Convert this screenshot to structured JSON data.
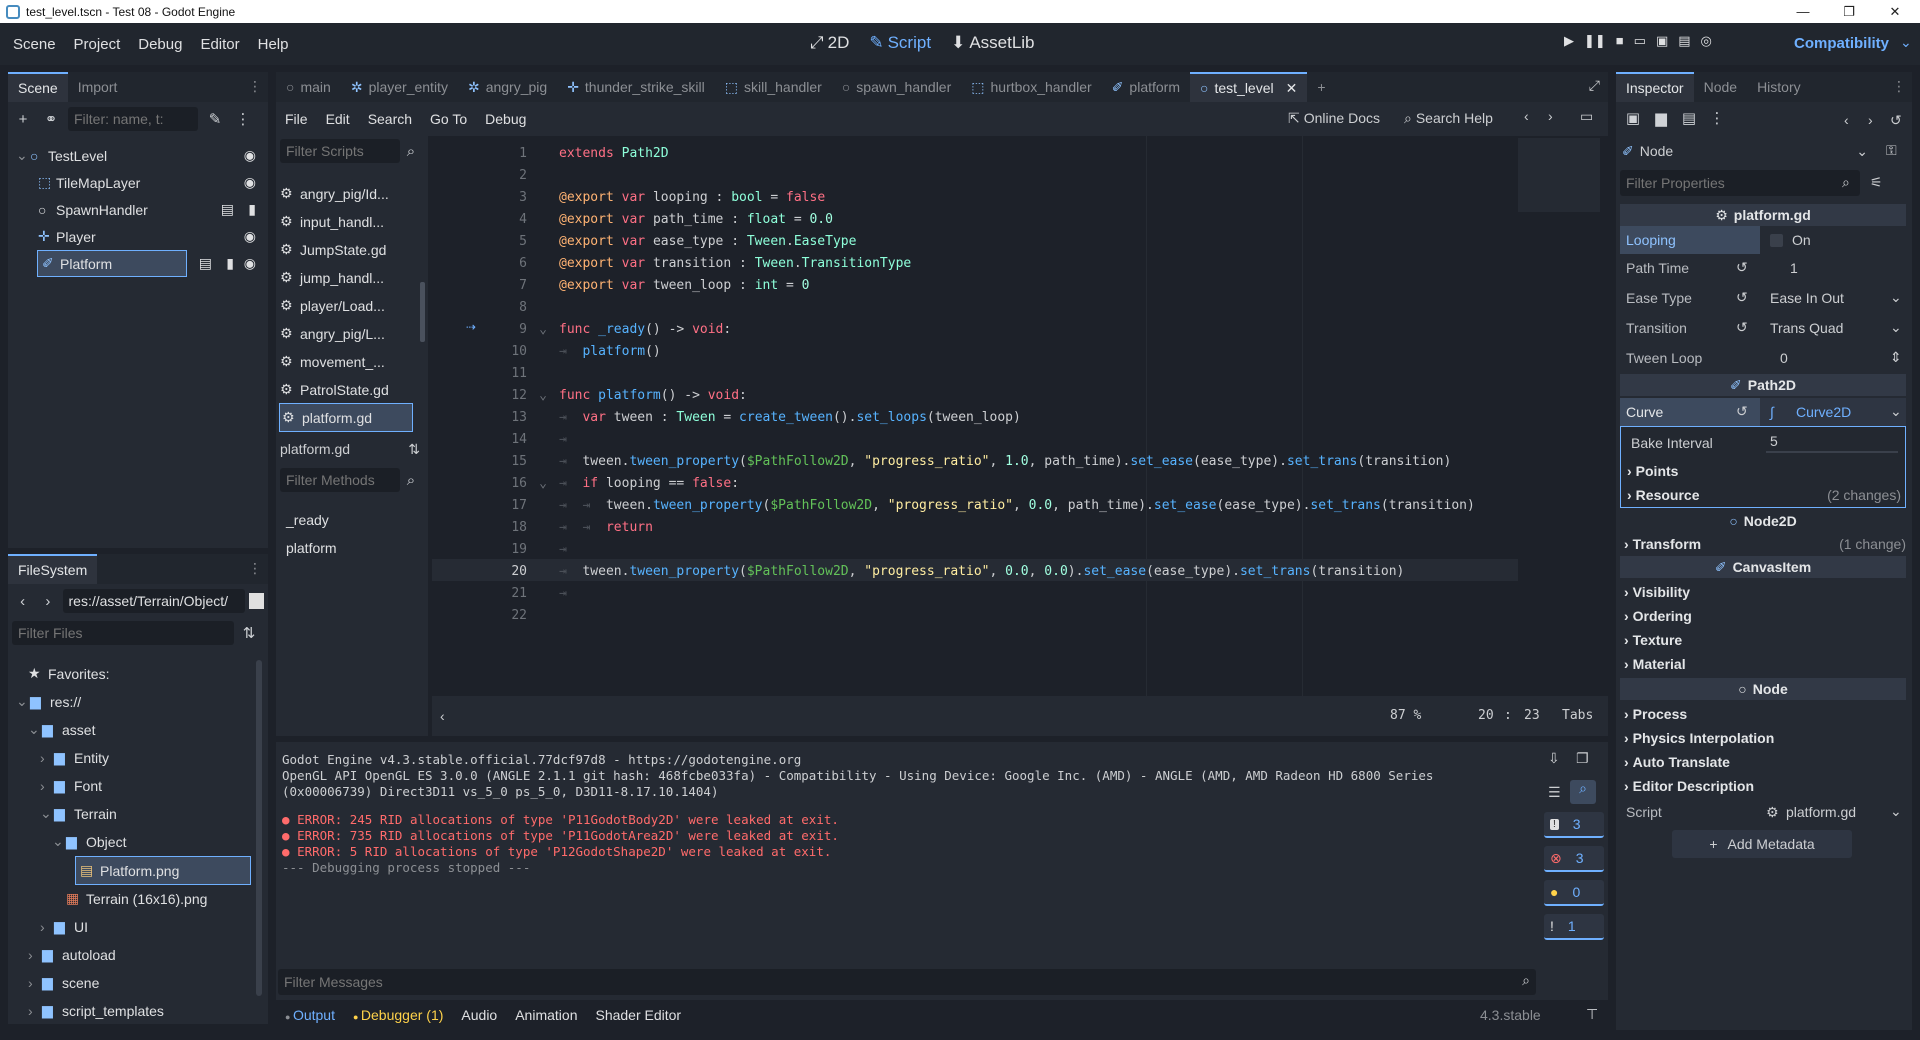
{
  "window": {
    "title": "test_level.tscn - Test 08 - Godot Engine",
    "min": "—",
    "max": "❐",
    "close": "✕"
  },
  "menu": [
    "Scene",
    "Project",
    "Debug",
    "Editor",
    "Help"
  ],
  "workspaces": [
    {
      "label": "2D",
      "icon": "⤢"
    },
    {
      "label": "Script",
      "icon": "✎"
    },
    {
      "label": "AssetLib",
      "icon": "⬇"
    }
  ],
  "renderer": "Compatibility",
  "scene_panel": {
    "tabs": [
      "Scene",
      "Import"
    ],
    "filter_placeholder": "Filter: name, t:",
    "nodes": [
      {
        "label": "TestLevel",
        "icon": "○"
      },
      {
        "label": "TileMapLayer",
        "icon": "⬚"
      },
      {
        "label": "SpawnHandler",
        "icon": "○"
      },
      {
        "label": "Player",
        "icon": "✛"
      },
      {
        "label": "Platform",
        "icon": "✐"
      }
    ]
  },
  "filesystem": {
    "title": "FileSystem",
    "path": "res://asset/Terrain/Object/",
    "filter_placeholder": "Filter Files",
    "items": [
      {
        "label": "Favorites:",
        "icon": "★"
      },
      {
        "label": "res://",
        "icon": "▆"
      },
      {
        "label": "asset",
        "icon": "▆"
      },
      {
        "label": "Entity",
        "icon": "▆"
      },
      {
        "label": "Font",
        "icon": "▆"
      },
      {
        "label": "Terrain",
        "icon": "▆"
      },
      {
        "label": "Object",
        "icon": "▆"
      },
      {
        "label": "Platform.png",
        "icon": "▤"
      },
      {
        "label": "Terrain (16x16).png",
        "icon": "▦"
      },
      {
        "label": "UI",
        "icon": "▆"
      },
      {
        "label": "autoload",
        "icon": "▆"
      },
      {
        "label": "scene",
        "icon": "▆"
      },
      {
        "label": "script_templates",
        "icon": "▆"
      }
    ]
  },
  "script_tabs": [
    "main",
    "player_entity",
    "angry_pig",
    "thunder_strike_skill",
    "skill_handler",
    "spawn_handler",
    "hurtbox_handler",
    "platform",
    "test_level"
  ],
  "script_menu": [
    "File",
    "Edit",
    "Search",
    "Go To",
    "Debug"
  ],
  "online_docs": "Online Docs",
  "search_help": "Search Help",
  "script_list": {
    "filter_placeholder": "Filter Scripts",
    "items": [
      "angry_pig/Id...",
      "input_handl...",
      "JumpState.gd",
      "jump_handl...",
      "player/Load...",
      "angry_pig/L...",
      "movement_...",
      "PatrolState.gd",
      "platform.gd"
    ],
    "current": "platform.gd",
    "methods_placeholder": "Filter Methods",
    "methods": [
      "_ready",
      "platform"
    ]
  },
  "code": {
    "lines": [
      [
        [
          "kw",
          "extends "
        ],
        [
          "ty",
          "Path2D"
        ]
      ],
      [],
      [
        [
          "an",
          "@export "
        ],
        [
          "kw",
          "var "
        ],
        [
          "id",
          "looping : "
        ],
        [
          "ty",
          "bool"
        ],
        [
          "id",
          " = "
        ],
        [
          "kw",
          "false"
        ]
      ],
      [
        [
          "an",
          "@export "
        ],
        [
          "kw",
          "var "
        ],
        [
          "id",
          "path_time : "
        ],
        [
          "ty",
          "float"
        ],
        [
          "id",
          " = "
        ],
        [
          "num",
          "0.0"
        ]
      ],
      [
        [
          "an",
          "@export "
        ],
        [
          "kw",
          "var "
        ],
        [
          "id",
          "ease_type : "
        ],
        [
          "ty",
          "Tween"
        ],
        [
          "id",
          "."
        ],
        [
          "ty",
          "EaseType"
        ]
      ],
      [
        [
          "an",
          "@export "
        ],
        [
          "kw",
          "var "
        ],
        [
          "id",
          "transition : "
        ],
        [
          "ty",
          "Tween"
        ],
        [
          "id",
          "."
        ],
        [
          "ty",
          "TransitionType"
        ]
      ],
      [
        [
          "an",
          "@export "
        ],
        [
          "kw",
          "var "
        ],
        [
          "id",
          "tween_loop : "
        ],
        [
          "ty",
          "int"
        ],
        [
          "id",
          " = "
        ],
        [
          "num",
          "0"
        ]
      ],
      [],
      [
        [
          "kw",
          "func "
        ],
        [
          "fn",
          "_ready"
        ],
        [
          "id",
          "() -> "
        ],
        [
          "kw",
          "void"
        ],
        [
          "id",
          ":"
        ]
      ],
      [
        [
          "tb",
          "⇥  "
        ],
        [
          "fn",
          "platform"
        ],
        [
          "id",
          "()"
        ]
      ],
      [],
      [
        [
          "kw",
          "func "
        ],
        [
          "fn",
          "platform"
        ],
        [
          "id",
          "() -> "
        ],
        [
          "kw",
          "void"
        ],
        [
          "id",
          ":"
        ]
      ],
      [
        [
          "tb",
          "⇥  "
        ],
        [
          "kw",
          "var "
        ],
        [
          "id",
          "tween : "
        ],
        [
          "ty",
          "Tween"
        ],
        [
          "id",
          " = "
        ],
        [
          "fn",
          "create_tween"
        ],
        [
          "id",
          "()."
        ],
        [
          "fn",
          "set_loops"
        ],
        [
          "id",
          "(tween_loop)"
        ]
      ],
      [
        [
          "tb",
          "⇥"
        ]
      ],
      [
        [
          "tb",
          "⇥  "
        ],
        [
          "id",
          "tween."
        ],
        [
          "fn",
          "tween_property"
        ],
        [
          "id",
          "("
        ],
        [
          "np",
          "$PathFollow2D"
        ],
        [
          "id",
          ", "
        ],
        [
          "st",
          "\"progress_ratio\""
        ],
        [
          "id",
          ", "
        ],
        [
          "num",
          "1.0"
        ],
        [
          "id",
          ", path_time)."
        ],
        [
          "fn",
          "set_ease"
        ],
        [
          "id",
          "(ease_type)."
        ],
        [
          "fn",
          "set_trans"
        ],
        [
          "id",
          "(transition)"
        ]
      ],
      [
        [
          "tb",
          "⇥  "
        ],
        [
          "kw",
          "if "
        ],
        [
          "id",
          "looping == "
        ],
        [
          "kw",
          "false"
        ],
        [
          "id",
          ":"
        ]
      ],
      [
        [
          "tb",
          "⇥  ⇥  "
        ],
        [
          "id",
          "tween."
        ],
        [
          "fn",
          "tween_property"
        ],
        [
          "id",
          "("
        ],
        [
          "np",
          "$PathFollow2D"
        ],
        [
          "id",
          ", "
        ],
        [
          "st",
          "\"progress_ratio\""
        ],
        [
          "id",
          ", "
        ],
        [
          "num",
          "0.0"
        ],
        [
          "id",
          ", path_time)."
        ],
        [
          "fn",
          "set_ease"
        ],
        [
          "id",
          "(ease_type)."
        ],
        [
          "fn",
          "set_trans"
        ],
        [
          "id",
          "(transition)"
        ]
      ],
      [
        [
          "tb",
          "⇥  ⇥  "
        ],
        [
          "kw",
          "return"
        ]
      ],
      [
        [
          "tb",
          "⇥"
        ]
      ],
      [
        [
          "tb",
          "⇥  "
        ],
        [
          "id",
          "tween."
        ],
        [
          "fn",
          "tween_property"
        ],
        [
          "id",
          "("
        ],
        [
          "np",
          "$PathFollow2D"
        ],
        [
          "id",
          ", "
        ],
        [
          "st",
          "\"progress_ratio\""
        ],
        [
          "id",
          ", "
        ],
        [
          "num",
          "0.0"
        ],
        [
          "id",
          ", "
        ],
        [
          "num",
          "0.0"
        ],
        [
          "id",
          ")."
        ],
        [
          "fn",
          "set_ease"
        ],
        [
          "id",
          "(ease_type)."
        ],
        [
          "fn",
          "set_trans"
        ],
        [
          "id",
          "(transition)"
        ]
      ],
      [
        [
          "tb",
          "⇥"
        ]
      ],
      []
    ],
    "current_line": 20,
    "zoom": "87 %",
    "line": "20",
    "col": "23",
    "indent": "Tabs"
  },
  "output": {
    "lines": [
      "Godot Engine v4.3.stable.official.77dcf97d8 - https://godotengine.org",
      "OpenGL API OpenGL ES 3.0.0 (ANGLE 2.1.1 git hash: 468fcbe033fa) - Compatibility - Using Device: Google Inc. (AMD) - ANGLE (AMD, AMD Radeon HD 6800 Series",
      "(0x00006739) Direct3D11 vs_5_0 ps_5_0, D3D11-8.17.10.1404)"
    ],
    "errors": [
      "ERROR: 245 RID allocations of type 'P11GodotBody2D' were leaked at exit.",
      "ERROR: 735 RID allocations of type 'P11GodotArea2D' were leaked at exit.",
      "ERROR: 5 RID allocations of type 'P12GodotShape2D' were leaked at exit."
    ],
    "stopped": "--- Debugging process stopped ---",
    "counts": [
      "3",
      "3",
      "0",
      "1"
    ],
    "filter_placeholder": "Filter Messages"
  },
  "bottom_tabs": [
    "Output",
    "Debugger (1)",
    "Audio",
    "Animation",
    "Shader Editor"
  ],
  "version": "4.3.stable",
  "inspector": {
    "tabs": [
      "Inspector",
      "Node",
      "History"
    ],
    "node": "Node",
    "filter_placeholder": "Filter Properties",
    "script_header": "platform.gd",
    "looping_label": "Looping",
    "looping_value": "On",
    "path_time_label": "Path Time",
    "path_time_value": "1",
    "ease_label": "Ease Type",
    "ease_value": "Ease In Out",
    "trans_label": "Transition",
    "trans_value": "Trans Quad",
    "tween_loop_label": "Tween Loop",
    "tween_loop_value": "0",
    "path2d": "Path2D",
    "curve_label": "Curve",
    "curve_value": "Curve2D",
    "bake_label": "Bake Interval",
    "bake_value": "5",
    "points": "Points",
    "resource": "Resource",
    "resource_changes": "(2 changes)",
    "node2d": "Node2D",
    "transform": "Transform",
    "transform_changes": "(1 change)",
    "canvasitem": "CanvasItem",
    "ci_groups": [
      "Visibility",
      "Ordering",
      "Texture",
      "Material"
    ],
    "node_groups": [
      "Process",
      "Physics Interpolation",
      "Auto Translate",
      "Editor Description"
    ],
    "script_label": "Script",
    "script_value": "platform.gd",
    "add_metadata": "Add Metadata"
  }
}
